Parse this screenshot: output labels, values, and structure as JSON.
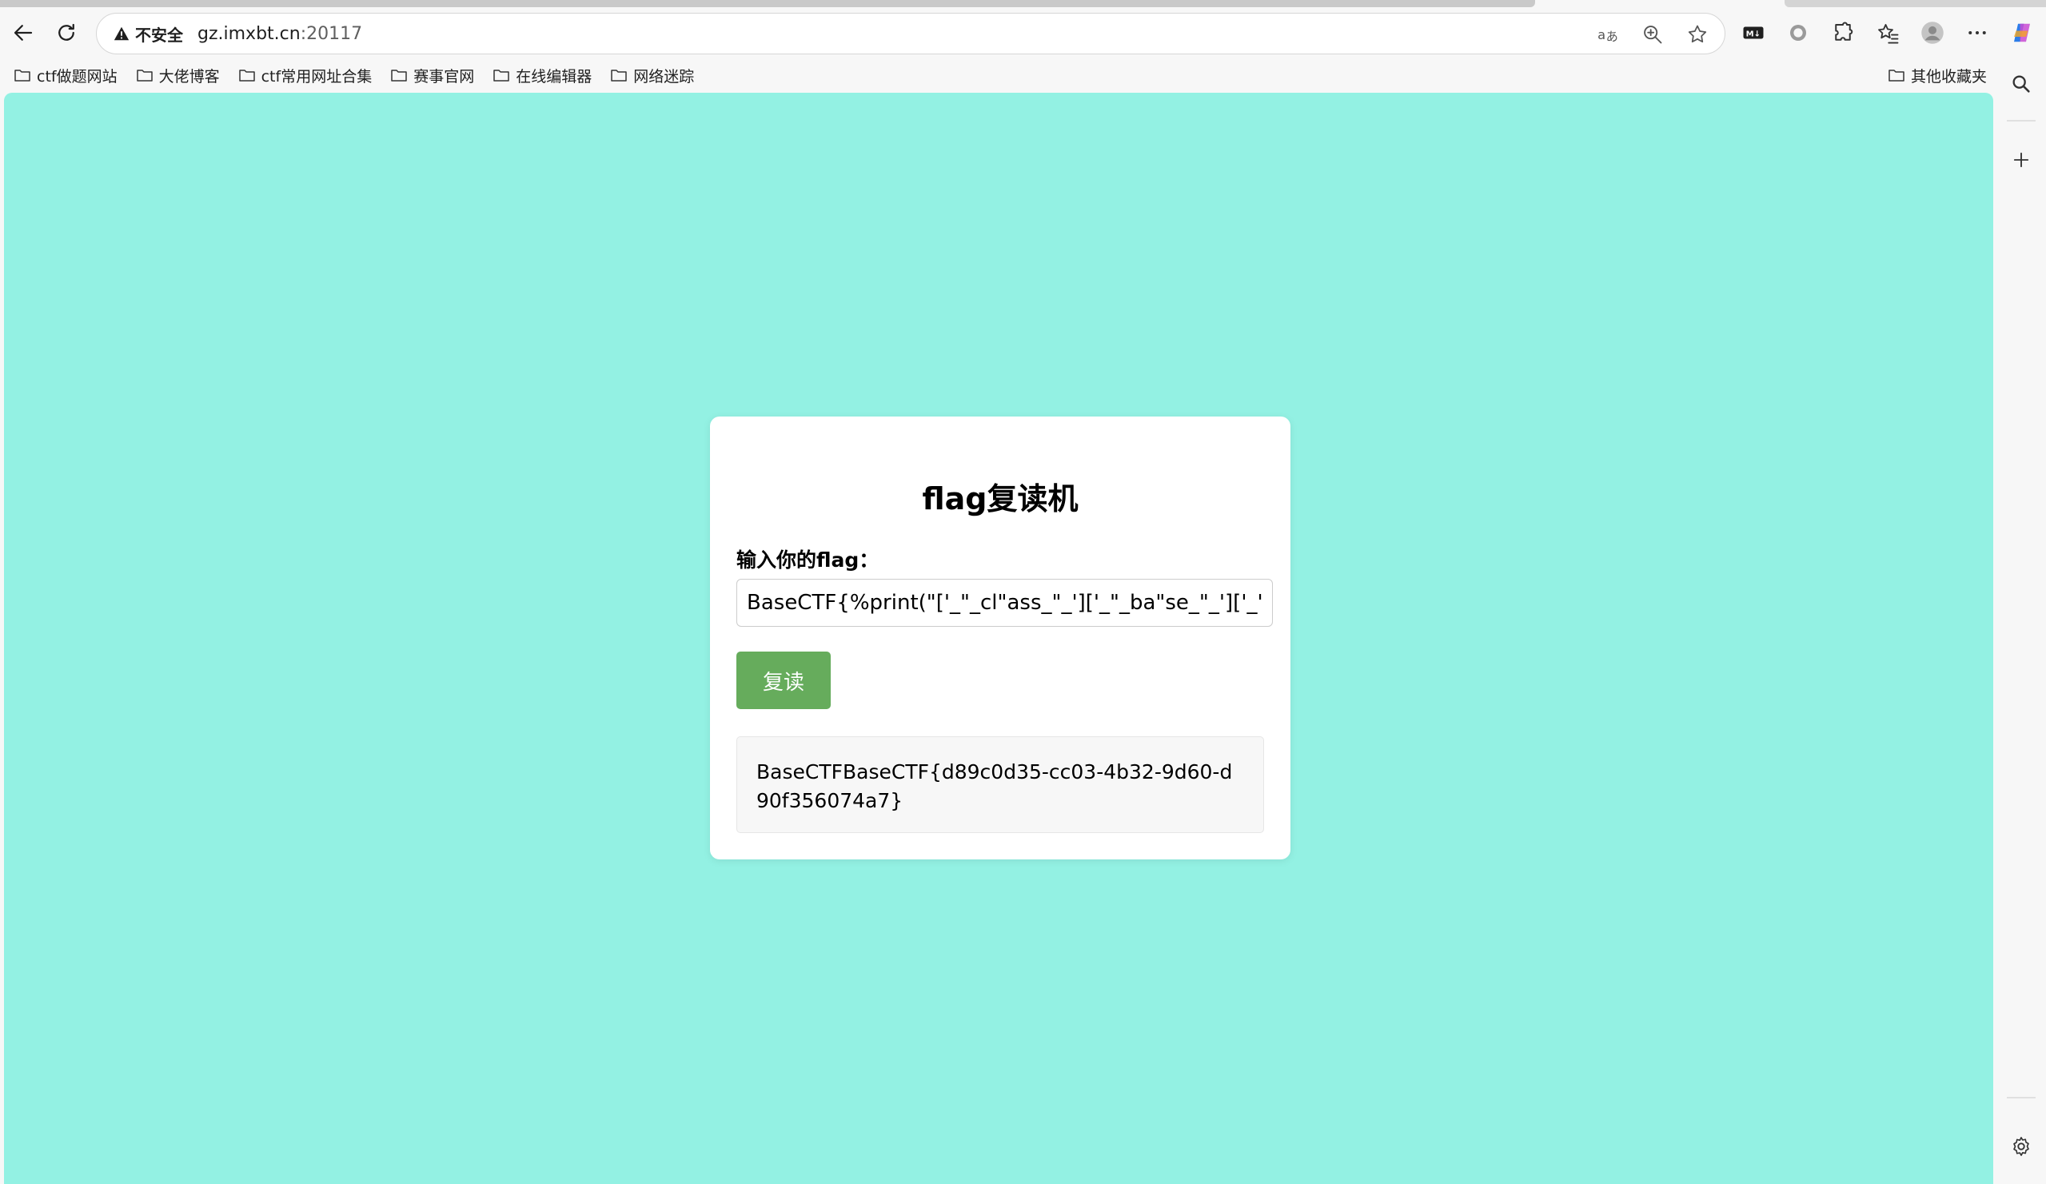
{
  "browser": {
    "security_label": "不安全",
    "url_host": "gz.imxbt.cn",
    "url_port": ":20117",
    "bookmarks": [
      "ctf做题网站",
      "大佬博客",
      "ctf常用网址合集",
      "赛事官网",
      "在线编辑器",
      "网络迷踪"
    ],
    "other_bookmarks": "其他收藏夹",
    "addr_icons": [
      "translate-icon",
      "zoom-icon",
      "favorite-star-icon"
    ],
    "toolbar_icons": [
      "md-extension-icon",
      "circle-extension-icon",
      "extensions-puzzle-icon",
      "favorites-icon",
      "profile-avatar",
      "more-menu-icon",
      "copilot-icon"
    ]
  },
  "page": {
    "background": "#93f1e3",
    "title": "flag复读机",
    "input_label": "输入你的flag：",
    "input_value": "BaseCTF{%print(\"['_\"_cl\"ass_\"_']['_\"_ba\"se_\"_']['_\"_sub",
    "submit_label": "复读",
    "submit_color": "#66ac5c",
    "result_text": "BaseCTFBaseCTF{d89c0d35-cc03-4b32-9d60-d90f356074a7}"
  }
}
